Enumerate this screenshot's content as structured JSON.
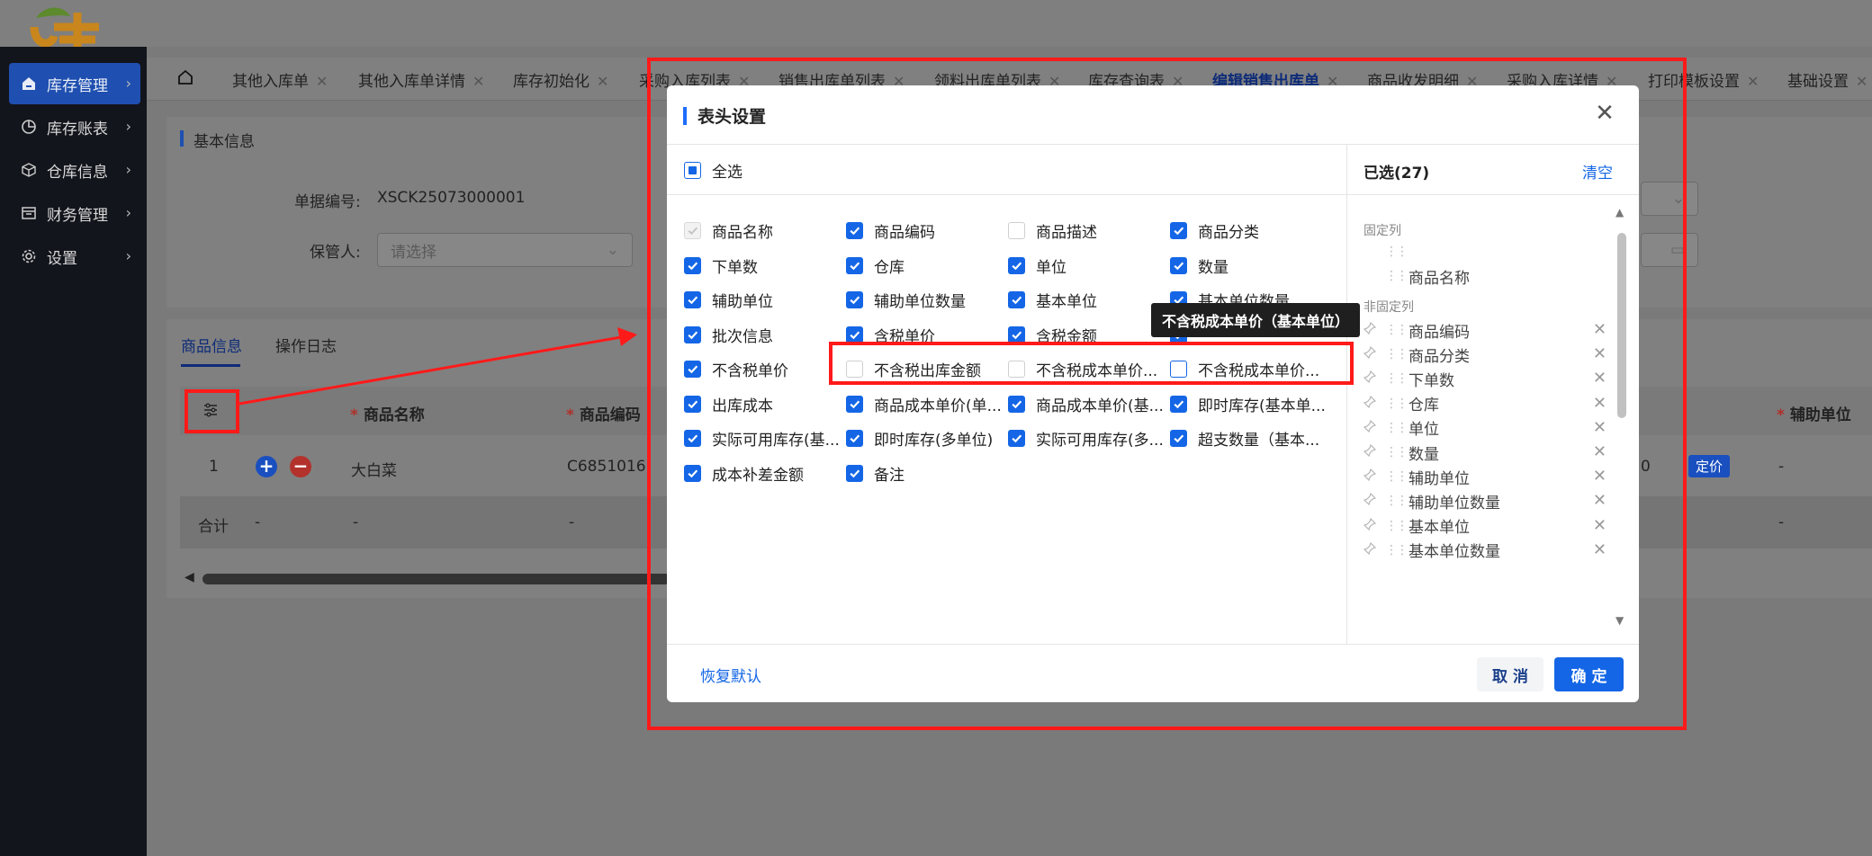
{
  "sidebar": {
    "items": [
      {
        "label": "库存管理",
        "icon": "home-icon"
      },
      {
        "label": "库存账表",
        "icon": "pie-chart-icon"
      },
      {
        "label": "仓库信息",
        "icon": "cube-icon"
      },
      {
        "label": "财务管理",
        "icon": "ledger-icon"
      },
      {
        "label": "设置",
        "icon": "gear-icon"
      }
    ]
  },
  "tabs": [
    {
      "label": "其他入库单"
    },
    {
      "label": "其他入库单详情"
    },
    {
      "label": "库存初始化"
    },
    {
      "label": "采购入库列表"
    },
    {
      "label": "销售出库单列表"
    },
    {
      "label": "领料出库单列表"
    },
    {
      "label": "库存查询表"
    },
    {
      "label": "编辑销售出库单"
    },
    {
      "label": "商品收发明细"
    },
    {
      "label": "采购入库详情"
    },
    {
      "label": "打印模板设置"
    },
    {
      "label": "基础设置"
    }
  ],
  "page": {
    "section_title": "基本信息",
    "doc_no_label": "单据编号:",
    "doc_no_value": "XSCK25073000001",
    "keeper_label": "保管人:",
    "keeper_placeholder": "请选择",
    "sub_tabs": [
      "商品信息",
      "操作日志"
    ],
    "col_product_name": "商品名称",
    "col_product_code": "商品编码",
    "col_aux_unit": "辅助单位",
    "row_index": "1",
    "row_product": "大白菜",
    "row_code": "C6851016",
    "row_qty_tail": "0",
    "row_badge": "定价",
    "row_dash": "-",
    "sum_label": "合计",
    "sum_dash": "-"
  },
  "modal": {
    "title": "表头设置",
    "select_all": "全选",
    "columns": [
      {
        "label": "商品名称",
        "state": "disabled"
      },
      {
        "label": "商品编码",
        "state": "checked"
      },
      {
        "label": "商品描述",
        "state": "unchecked"
      },
      {
        "label": "商品分类",
        "state": "checked"
      },
      {
        "label": "下单数",
        "state": "checked"
      },
      {
        "label": "仓库",
        "state": "checked"
      },
      {
        "label": "单位",
        "state": "checked"
      },
      {
        "label": "数量",
        "state": "checked"
      },
      {
        "label": "辅助单位",
        "state": "checked"
      },
      {
        "label": "辅助单位数量",
        "state": "checked"
      },
      {
        "label": "基本单位",
        "state": "checked"
      },
      {
        "label": "基本单位数量",
        "state": "checked"
      },
      {
        "label": "批次信息",
        "state": "checked"
      },
      {
        "label": "含税单价",
        "state": "checked"
      },
      {
        "label": "含税金额",
        "state": "checked"
      },
      {
        "label": "",
        "state": "checked"
      },
      {
        "label": "不含税单价",
        "state": "checked"
      },
      {
        "label": "不含税出库金额",
        "state": "unchecked"
      },
      {
        "label": "不含税成本单价...",
        "state": "unchecked"
      },
      {
        "label": "不含税成本单价...",
        "state": "focus"
      },
      {
        "label": "出库成本",
        "state": "checked"
      },
      {
        "label": "商品成本单价(单...",
        "state": "checked"
      },
      {
        "label": "商品成本单价(基...",
        "state": "checked"
      },
      {
        "label": "即时库存(基本单...",
        "state": "checked"
      },
      {
        "label": "实际可用库存(基...",
        "state": "checked"
      },
      {
        "label": "即时库存(多单位)",
        "state": "checked"
      },
      {
        "label": "实际可用库存(多...",
        "state": "checked"
      },
      {
        "label": "超支数量（基本...",
        "state": "checked"
      },
      {
        "label": "成本补差金额",
        "state": "checked"
      },
      {
        "label": "备注",
        "state": "checked"
      }
    ],
    "selected_title": "已选(27)",
    "clear": "清空",
    "fixed_group": "固定列",
    "fixed_items": [
      "",
      "商品名称"
    ],
    "nonfixed_group": "非固定列",
    "nonfixed_items": [
      "商品编码",
      "商品分类",
      "下单数",
      "仓库",
      "单位",
      "数量",
      "辅助单位",
      "辅助单位数量",
      "基本单位",
      "基本单位数量"
    ],
    "restore": "恢复默认",
    "cancel": "取 消",
    "ok": "确 定",
    "tooltip": "不含税成本单价（基本单位）"
  },
  "colors": {
    "accent": "#1466e6",
    "sidebar_bg": "#13151c",
    "annotation_red": "#ff1a1a"
  }
}
